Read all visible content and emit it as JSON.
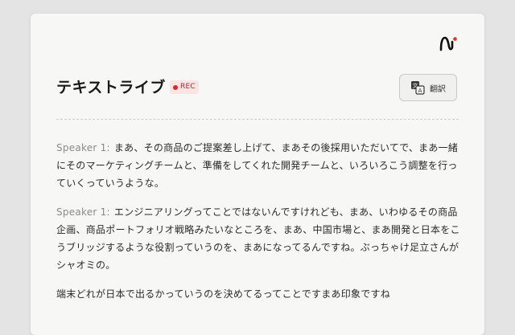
{
  "header": {
    "title": "テキストライブ",
    "rec_label": "REC",
    "translate_label": "翻訳"
  },
  "icons": {
    "logo": "brand-logo-icon",
    "translate": "translate-icon"
  },
  "colors": {
    "rec_red": "#d22b2b",
    "rec_bg": "#fbe4e4",
    "speaker_gray": "#8a8a8a"
  },
  "transcript": [
    {
      "speaker": "Speaker 1:",
      "text": "まあ、その商品のご提案差し上げて、まあその後採用いただいてで、まあ一緒にそのマーケティングチームと、準備をしてくれた開発チームと、いろいろこう調整を行っていくっていうような。"
    },
    {
      "speaker": "Speaker 1:",
      "text": "エンジニアリングってことではないんですけれども、まあ、いわゆるその商品企画、商品ポートフォリオ戦略みたいなところを、まあ、中国市場と、まあ開発と日本をこうブリッジするような役割っていうのを、まあになってるんですね。ぶっちゃけ足立さんがシャオミの。"
    },
    {
      "speaker": "",
      "text": "端末どれが日本で出るかっていうのを決めてるってことですまあ印象ですね"
    }
  ]
}
